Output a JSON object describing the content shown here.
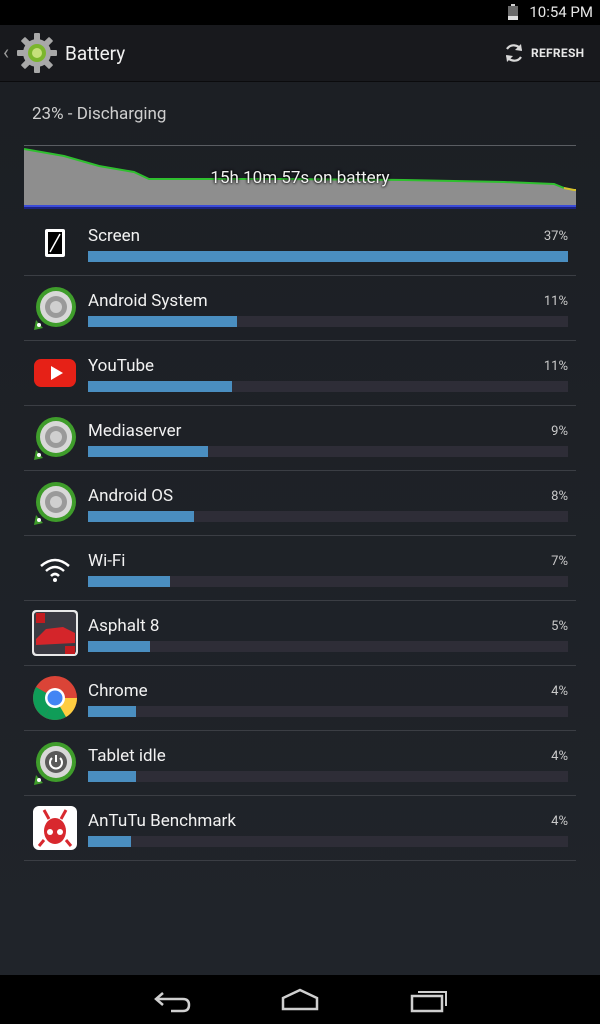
{
  "status_bar": {
    "time": "10:54 PM"
  },
  "action_bar": {
    "title": "Battery",
    "refresh_label": "REFRESH"
  },
  "summary": {
    "status": "23% - Discharging",
    "graph_label": "15h 10m 57s on battery",
    "graph_fill_color": "#8e8e8e",
    "graph_line_color": "#2fbf2f"
  },
  "usage": [
    {
      "name": "Screen",
      "percent": "37%",
      "fraction": 1.0,
      "icon": "screen-icon"
    },
    {
      "name": "Android System",
      "percent": "11%",
      "fraction": 0.31,
      "icon": "android-system-icon"
    },
    {
      "name": "YouTube",
      "percent": "11%",
      "fraction": 0.3,
      "icon": "youtube-icon"
    },
    {
      "name": "Mediaserver",
      "percent": "9%",
      "fraction": 0.25,
      "icon": "mediaserver-icon"
    },
    {
      "name": "Android OS",
      "percent": "8%",
      "fraction": 0.22,
      "icon": "android-os-icon"
    },
    {
      "name": "Wi-Fi",
      "percent": "7%",
      "fraction": 0.17,
      "icon": "wifi-icon"
    },
    {
      "name": "Asphalt 8",
      "percent": "5%",
      "fraction": 0.13,
      "icon": "asphalt-8-icon"
    },
    {
      "name": "Chrome",
      "percent": "4%",
      "fraction": 0.1,
      "icon": "chrome-icon"
    },
    {
      "name": "Tablet idle",
      "percent": "4%",
      "fraction": 0.1,
      "icon": "tablet-idle-icon"
    },
    {
      "name": "AnTuTu Benchmark",
      "percent": "4%",
      "fraction": 0.09,
      "icon": "antutu-icon"
    }
  ],
  "colors": {
    "bar_fill": "#4a8ec0",
    "bar_track": "#2e2d37",
    "background": "#1e2126"
  }
}
